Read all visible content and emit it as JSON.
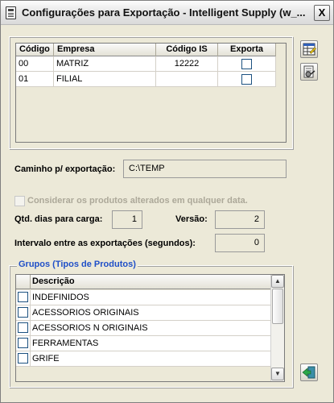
{
  "window": {
    "title": "Configurações para Exportação - Intelligent Supply (w_...",
    "close_label": "X"
  },
  "companies": {
    "headers": [
      "Código",
      "Empresa",
      "Código IS",
      "Exporta"
    ],
    "rows": [
      {
        "codigo": "00",
        "empresa": "MATRIZ",
        "codigo_is": "12222",
        "exporta": false
      },
      {
        "codigo": "01",
        "empresa": "FILIAL",
        "codigo_is": "",
        "exporta": false
      }
    ]
  },
  "export_path": {
    "label": "Caminho p/ exportação:",
    "value": "C:\\TEMP"
  },
  "consider_changed": {
    "label": "Considerar os produtos alterados em qualquer data.",
    "checked": false,
    "enabled": false
  },
  "days_for_load": {
    "label": "Qtd. dias para carga:",
    "value": "1"
  },
  "version": {
    "label": "Versão:",
    "value": "2"
  },
  "interval": {
    "label": "Intervalo entre as exportações (segundos):",
    "value": "0"
  },
  "groups": {
    "title": "Grupos (Tipos de Produtos)",
    "header": "Descrição",
    "rows": [
      {
        "label": "INDEFINIDOS",
        "checked": false
      },
      {
        "label": "ACESSORIOS ORIGINAIS",
        "checked": false
      },
      {
        "label": "ACESSORIOS N ORIGINAIS",
        "checked": false
      },
      {
        "label": "FERRAMENTAS",
        "checked": false
      },
      {
        "label": "GRIFE",
        "checked": false
      }
    ]
  },
  "toolbar": {
    "icons": [
      "grid-edit-icon",
      "config-icon",
      "exit-icon"
    ]
  },
  "colors": {
    "group_title": "#1f4fc8",
    "disabled_text": "#aca899",
    "window_bg": "#ece9d8"
  }
}
